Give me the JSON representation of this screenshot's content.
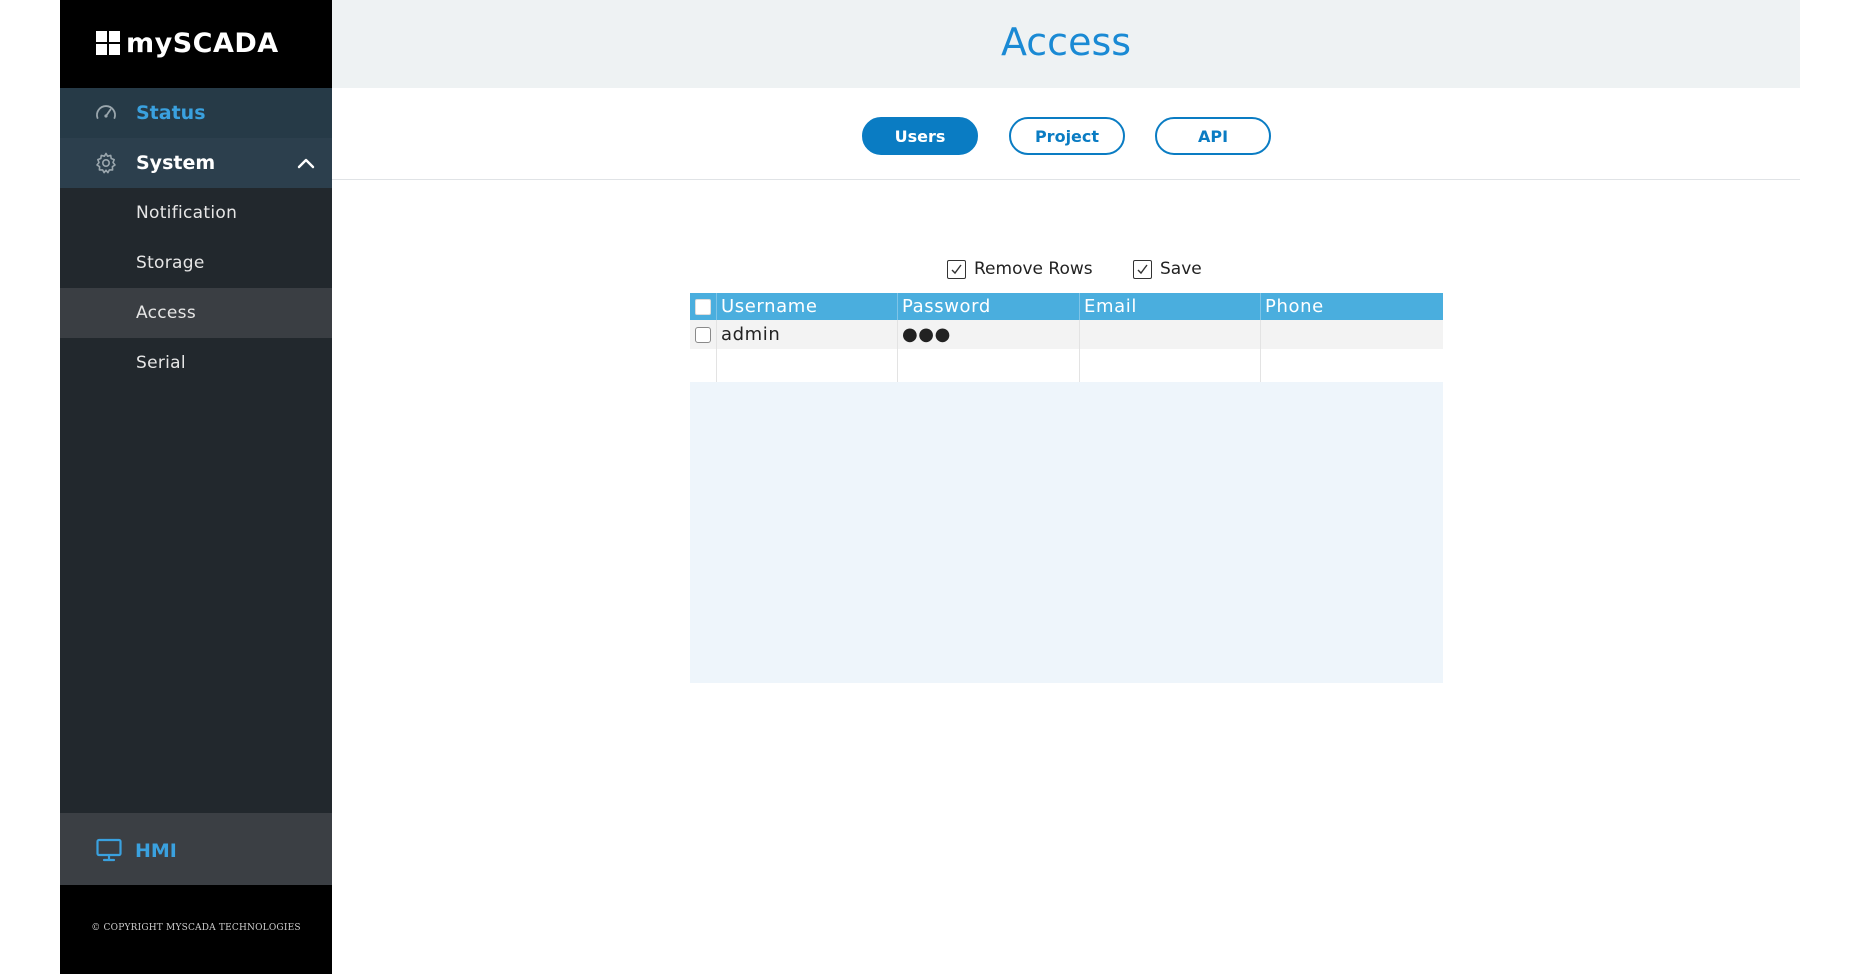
{
  "brand": {
    "name": "mySCADA"
  },
  "sidebar": {
    "status_label": "Status",
    "system_label": "System",
    "submenu": [
      {
        "label": "Notification"
      },
      {
        "label": "Storage"
      },
      {
        "label": "Access"
      },
      {
        "label": "Serial"
      }
    ],
    "active_item": "Access",
    "hmi_label": "HMI",
    "copyright": "© COPYRIGHT MYSCADA TECHNOLOGIES"
  },
  "header": {
    "title": "Access"
  },
  "tabs": [
    {
      "label": "Users",
      "active": true
    },
    {
      "label": "Project",
      "active": false
    },
    {
      "label": "API",
      "active": false
    }
  ],
  "options": {
    "remove_rows": {
      "label": "Remove Rows",
      "checked": true
    },
    "save": {
      "label": "Save",
      "checked": true
    }
  },
  "table": {
    "columns": [
      "Username",
      "Password",
      "Email",
      "Phone"
    ],
    "rows": [
      {
        "username": "admin",
        "password": "●●●",
        "email": "",
        "phone": ""
      }
    ]
  },
  "colors": {
    "accent": "#0a7cc3",
    "title_blue": "#1a8ad4",
    "grid_header": "#4aaede",
    "sidebar_bg": "#22282d"
  },
  "icons": {
    "status": "speedometer-icon",
    "system": "gear-icon",
    "hmi": "monitor-icon",
    "expand": "chevron-up-icon"
  }
}
